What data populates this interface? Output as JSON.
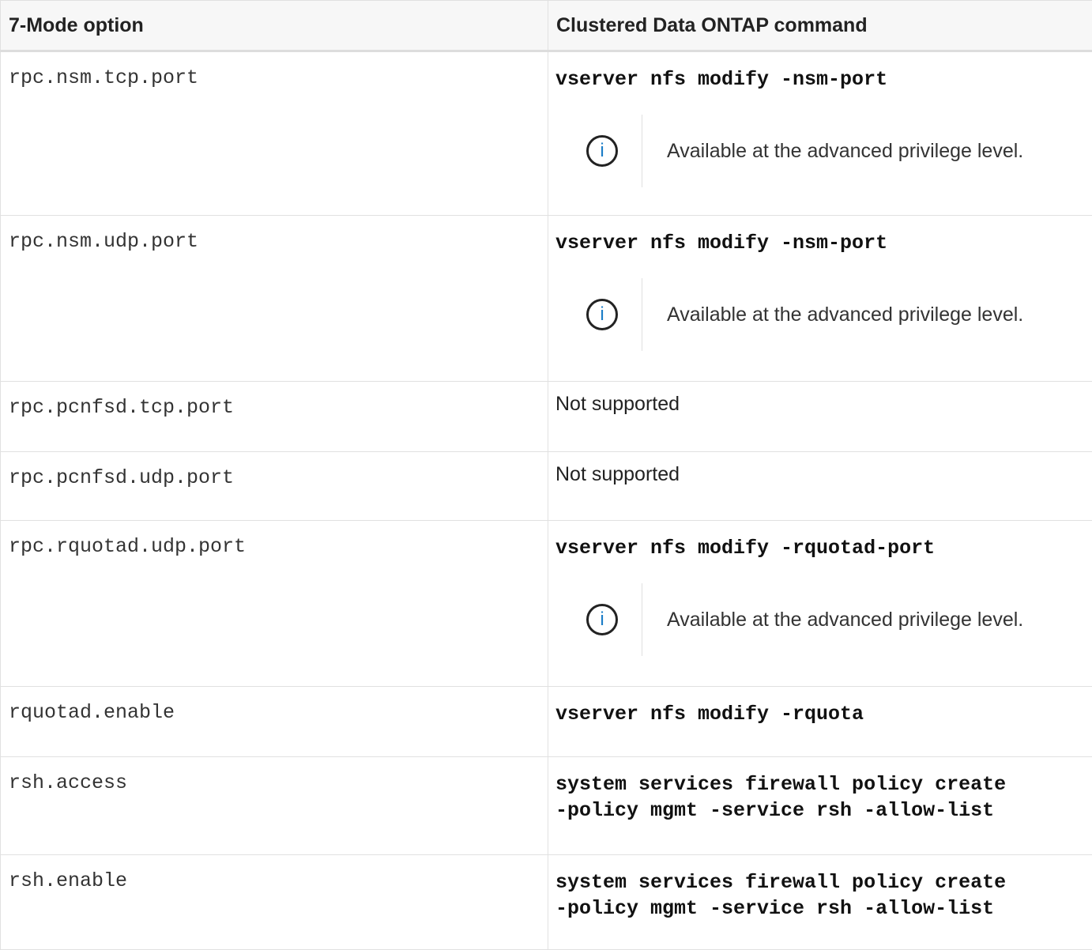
{
  "header": {
    "col1": "7-Mode option",
    "col2": "Clustered Data ONTAP command"
  },
  "rows": [
    {
      "option": "rpc.nsm.tcp.port",
      "command": "vserver nfs modify -nsm-port",
      "note": "Available at the advanced privilege level."
    },
    {
      "option": "rpc.nsm.udp.port",
      "command": "vserver nfs modify -nsm-port",
      "note": "Available at the advanced privilege level."
    },
    {
      "option": "rpc.pcnfsd.tcp.port",
      "plain": "Not supported"
    },
    {
      "option": "rpc.pcnfsd.udp.port",
      "plain": "Not supported"
    },
    {
      "option": "rpc.rquotad.udp.port",
      "command": "vserver nfs modify -rquotad-port",
      "note": "Available at the advanced privilege level."
    },
    {
      "option": "rquotad.enable",
      "command": "vserver nfs modify -rquota"
    },
    {
      "option": "rsh.access",
      "command": "system services firewall policy create\n-policy mgmt -service rsh -allow-list"
    },
    {
      "option": "rsh.enable",
      "command": "system services firewall policy create\n-policy mgmt -service rsh -allow-list"
    }
  ],
  "icons": {
    "note": "info-icon"
  },
  "colors": {
    "info_icon": "#1a7cc7",
    "header_bg": "#f7f7f7",
    "border": "#e1e1e1"
  }
}
